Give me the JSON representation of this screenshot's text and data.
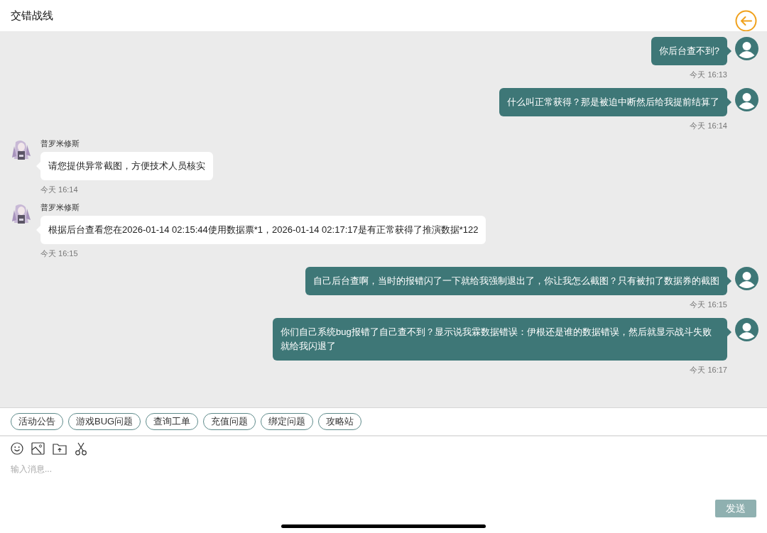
{
  "header": {
    "title": "交错战线"
  },
  "messages": [
    {
      "kind": "sent",
      "text": "你后台查不到?",
      "time": "今天 16:13"
    },
    {
      "kind": "sent",
      "text": "什么叫正常获得？那是被迫中断然后给我提前结算了",
      "time": "今天 16:14"
    },
    {
      "kind": "received",
      "sender": "普罗米修斯",
      "text": "请您提供异常截图，方便技术人员核实",
      "time": "今天 16:14"
    },
    {
      "kind": "received",
      "sender": "普罗米修斯",
      "text": "根据后台查看您在2026-01-14 02:15:44使用数据票*1，2026-01-14 02:17:17是有正常获得了推演数据*122",
      "time": "今天 16:15"
    },
    {
      "kind": "sent",
      "text": "自己后台查啊，当时的报错闪了一下就给我强制退出了，你让我怎么截图？只有被扣了数据券的截图",
      "time": "今天 16:15"
    },
    {
      "kind": "sent",
      "text": "你们自己系统bug报错了自己查不到？显示说我霖数据错误：伊根还是谁的数据错误，然后就显示战斗失败就给我闪退了",
      "time": "今天 16:17"
    }
  ],
  "quick_replies": [
    "活动公告",
    "游戏BUG问题",
    "查询工单",
    "充值问题",
    "绑定问题",
    "攻略站"
  ],
  "composer": {
    "placeholder": "输入消息...",
    "send_button": {
      "label": "发送",
      "disabled": true
    }
  }
}
